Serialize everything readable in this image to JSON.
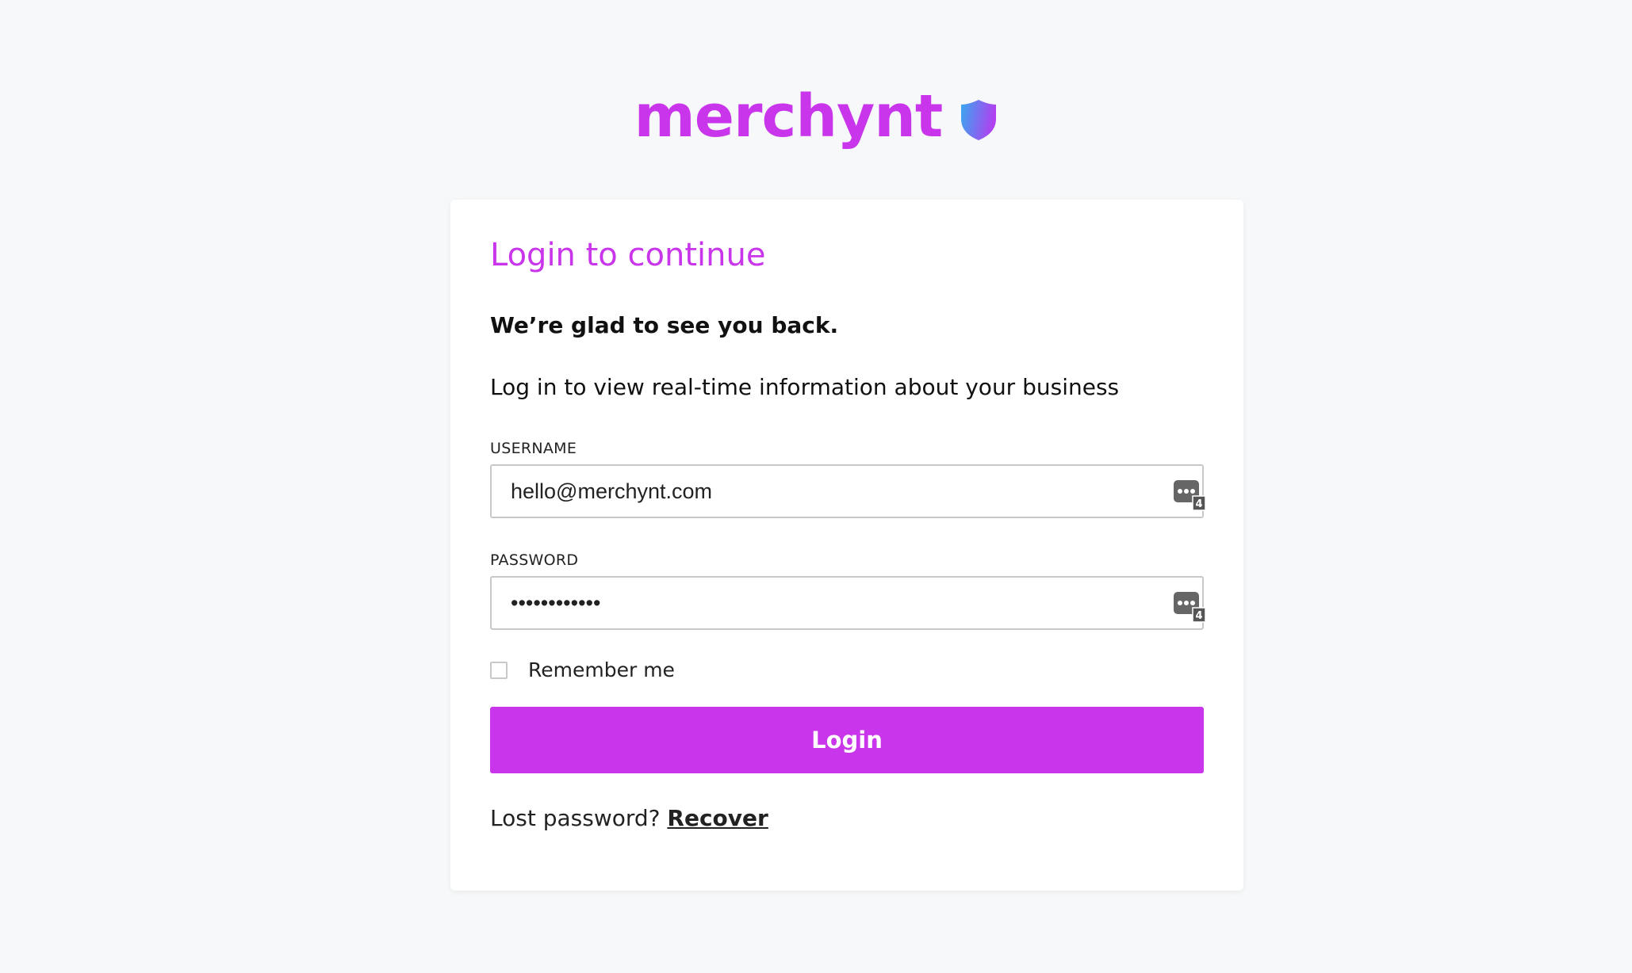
{
  "brand": {
    "name": "merchynt",
    "color": "#c935ea",
    "shield_gradient": [
      "#38a8f0",
      "#b140f0"
    ]
  },
  "login": {
    "title": "Login to continue",
    "welcome": "We’re glad to see you back.",
    "subtitle": "Log in to view real-time information about your business",
    "username_label": "USERNAME",
    "username_value": "hello@merchynt.com",
    "password_label": "PASSWORD",
    "password_value": "••••••••••••",
    "password_manager_icon": "password-manager-icon",
    "password_manager_badge": "4",
    "remember_label": "Remember me",
    "remember_checked": false,
    "login_button": "Login",
    "lost_password": "Lost password?",
    "recover_link": "Recover"
  }
}
